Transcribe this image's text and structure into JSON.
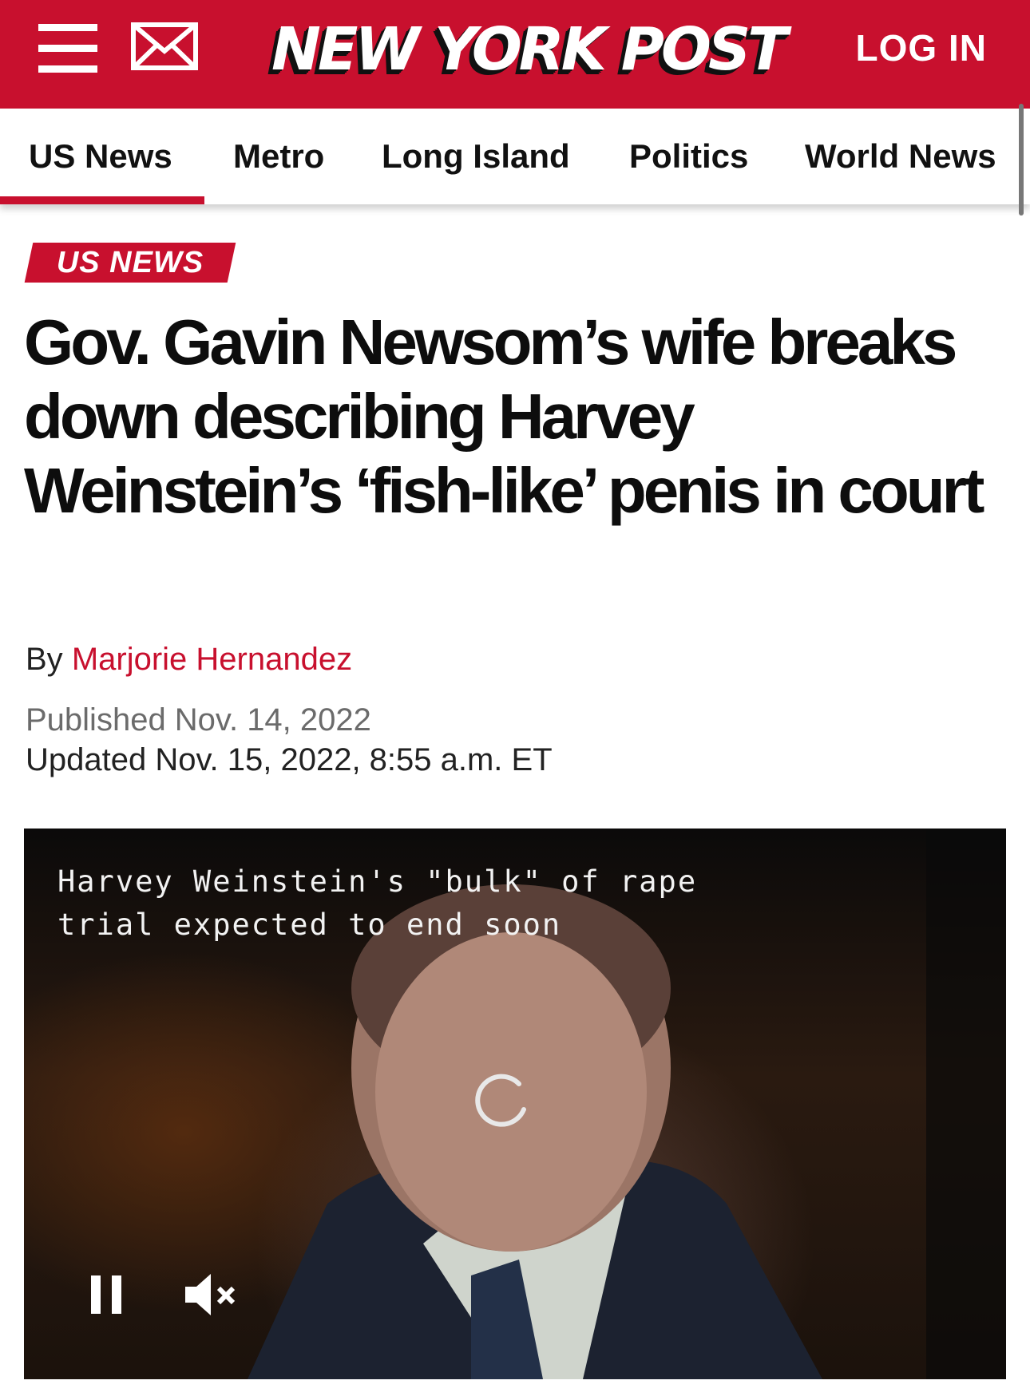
{
  "header": {
    "logo_text": "NEW YORK POST",
    "login_label": "LOG IN",
    "menu_icon": "hamburger-menu-icon",
    "mail_icon": "mail-icon",
    "brand_color": "#c8102e"
  },
  "nav": {
    "items": [
      {
        "label": "US News",
        "active": true
      },
      {
        "label": "Metro"
      },
      {
        "label": "Long Island"
      },
      {
        "label": "Politics"
      },
      {
        "label": "World News"
      }
    ]
  },
  "article": {
    "kicker": "US NEWS",
    "headline": "Gov. Gavin Newsom’s wife breaks down describing Harvey Weinstein’s ‘fish-like’ penis in court",
    "byline_prefix": "By",
    "author": "Marjorie Hernandez",
    "published": "Published Nov. 14, 2022",
    "updated": "Updated Nov. 15, 2022, 8:55 a.m. ET"
  },
  "video": {
    "title": "Harvey Weinstein's \"bulk\" of rape trial expected to end soon",
    "state": "loading",
    "controls": {
      "pause_icon": "pause-icon",
      "mute_icon": "muted-speaker-icon"
    }
  }
}
